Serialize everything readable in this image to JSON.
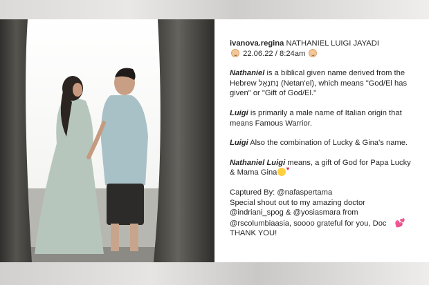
{
  "post": {
    "username": "ivanova.regina",
    "title": "NATHANIEL LUIGI JAYADI",
    "date_line": "22.06.22 / 8:24am",
    "para1": {
      "name": "Nathaniel",
      "l1": " is a biblical given name derived from the",
      "l2": "Hebrew נְתַנְאֵל (Netan'el), which means \"God/El has",
      "l3": "given\" or \"Gift of God/El.\""
    },
    "para2": {
      "name": "Luigi",
      "l1": " is primarily a male name of Italian origin that",
      "l2": "means Famous Warrior."
    },
    "para3": {
      "name": "Luigi",
      "l1": " Also the combination of Lucky & Gina's name."
    },
    "para4": {
      "name": "Nathaniel Luigi",
      "l1": " means, a gift of God for Papa Lucky",
      "l2": "& Mama Gina"
    },
    "credits": {
      "captured": "Captured By: @nafaspertama",
      "shout": "Special shout out to my amazing doctor",
      "doctors": "@indriani_spog & @yosiasmara from",
      "hospital": "@rscolumbiaasia, soooo grateful for you, Doc",
      "thanks": "THANK YOU!"
    }
  },
  "icons": [
    "baby-icon",
    "smiling-face-with-hearts-icon",
    "two-hearts-icon"
  ],
  "colors": {
    "text": "#262626",
    "heart": "#d7263d",
    "panel": "#ffffff"
  }
}
